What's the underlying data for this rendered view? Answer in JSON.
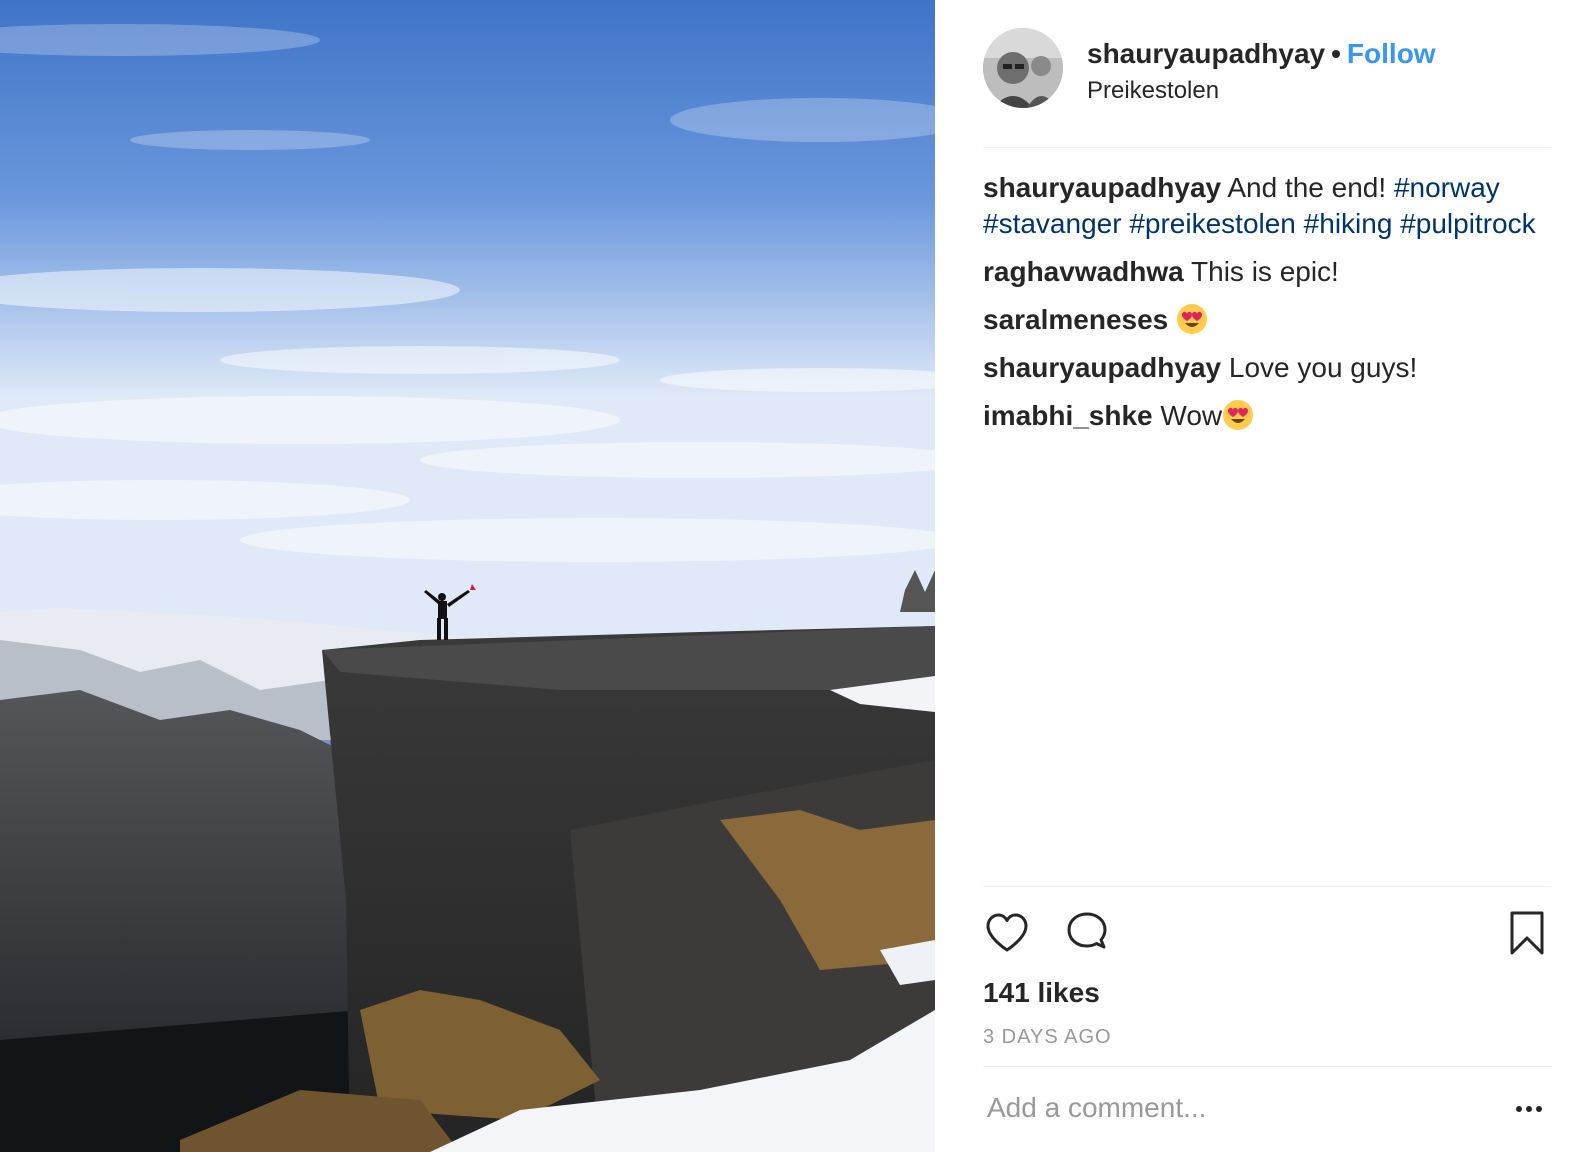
{
  "post": {
    "username": "shauryaupadhyay",
    "separator": "•",
    "follow_label": "Follow",
    "location": "Preikestolen"
  },
  "caption": {
    "username": "shauryaupadhyay",
    "text": "And the end!",
    "hashtags": [
      "#norway",
      "#stavanger",
      "#preikestolen",
      "#hiking",
      "#pulpitrock"
    ]
  },
  "comments": [
    {
      "username": "raghavwadhwa",
      "text": "This is epic!"
    },
    {
      "username": "saralmeneses",
      "text": "",
      "emoji": "heart-eyes-emoji"
    },
    {
      "username": "shauryaupadhyay",
      "text": "Love you guys!"
    },
    {
      "username": "imabhi_shke",
      "text": "Wow",
      "emoji": "heart-eyes-emoji"
    }
  ],
  "actions": {
    "like_icon": "heart-icon",
    "comment_icon": "speech-bubble-icon",
    "save_icon": "bookmark-icon"
  },
  "likes_text": "141 likes",
  "timestamp": "3 DAYS AGO",
  "add_comment": {
    "placeholder": "Add a comment...",
    "more_icon": "ellipsis-icon"
  },
  "colors": {
    "link_blue": "#3897f0",
    "hashtag_blue": "#003569",
    "text": "#262626",
    "muted": "#999999",
    "divider": "#efefef"
  }
}
